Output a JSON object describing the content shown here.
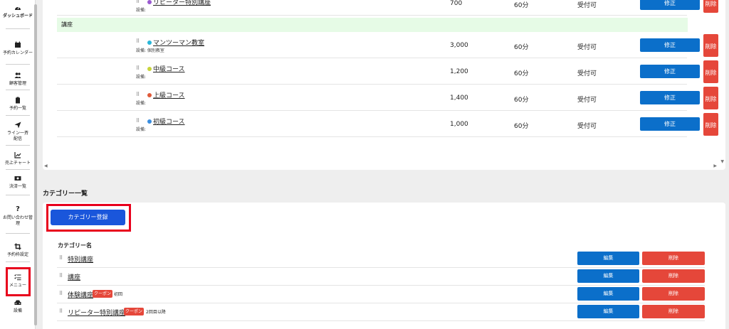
{
  "sidebar": {
    "items": [
      {
        "label": "ダッシュボード",
        "icon": "gauge-icon"
      },
      {
        "label": "予約カレンダー",
        "icon": "calendar-icon"
      },
      {
        "label": "顧客管理",
        "icon": "users-icon"
      },
      {
        "label": "予約一覧",
        "icon": "clipboard-icon"
      },
      {
        "label": "ライン一斉配信",
        "icon": "send-icon"
      },
      {
        "label": "売上チャート",
        "icon": "chart-icon"
      },
      {
        "label": "決済一覧",
        "icon": "payment-icon"
      },
      {
        "label": "お問い合わせ管理",
        "icon": "question-icon"
      },
      {
        "label": "予約枠設定",
        "icon": "crop-icon"
      },
      {
        "label": "メニュー",
        "icon": "list-icon"
      },
      {
        "label": "設備",
        "icon": "equipment-icon"
      }
    ]
  },
  "courses": {
    "partial_row": {
      "title": "リピーター特別講座",
      "sub": "設備:",
      "price": "700",
      "duration": "60分",
      "status": "受付可",
      "edit": "修正",
      "delete": "削除"
    },
    "category_label": "講座",
    "rows": [
      {
        "title": "マンツーマン教室",
        "sub": "設備: 個別教室",
        "dot_color": "#29b6d8",
        "price": "3,000",
        "duration": "60分",
        "status": "受付可",
        "edit": "修正",
        "delete": "削除"
      },
      {
        "title": "中級コース",
        "sub": "設備:",
        "dot_color": "#c8d43a",
        "price": "1,200",
        "duration": "60分",
        "status": "受付可",
        "edit": "修正",
        "delete": "削除"
      },
      {
        "title": "上級コース",
        "sub": "設備:",
        "dot_color": "#e05a3a",
        "price": "1,400",
        "duration": "60分",
        "status": "受付可",
        "edit": "修正",
        "delete": "削除"
      },
      {
        "title": "初級コース",
        "sub": "設備:",
        "dot_color": "#3a8ee0",
        "price": "1,000",
        "duration": "60分",
        "status": "受付可",
        "edit": "修正",
        "delete": "削除"
      }
    ]
  },
  "categories": {
    "section_title": "カテゴリー一覧",
    "register_button": "カテゴリー登録",
    "column_header": "カテゴリー名",
    "rows": [
      {
        "name": "特別講座",
        "coupon": "",
        "note": "",
        "edit": "編集",
        "delete": "削除"
      },
      {
        "name": "講座",
        "coupon": "",
        "note": "",
        "edit": "編集",
        "delete": "削除"
      },
      {
        "name": "体験講座",
        "coupon": "クーポン",
        "note": "初回",
        "edit": "編集",
        "delete": "削除"
      },
      {
        "name": "リピーター特別講座",
        "coupon": "クーポン",
        "note": "2回目以降",
        "edit": "編集",
        "delete": "削除"
      }
    ]
  },
  "colors": {
    "primary": "#0b6fca",
    "danger": "#e5473a",
    "highlight": "#e8001c",
    "category_bg": "#e6fbe6"
  }
}
